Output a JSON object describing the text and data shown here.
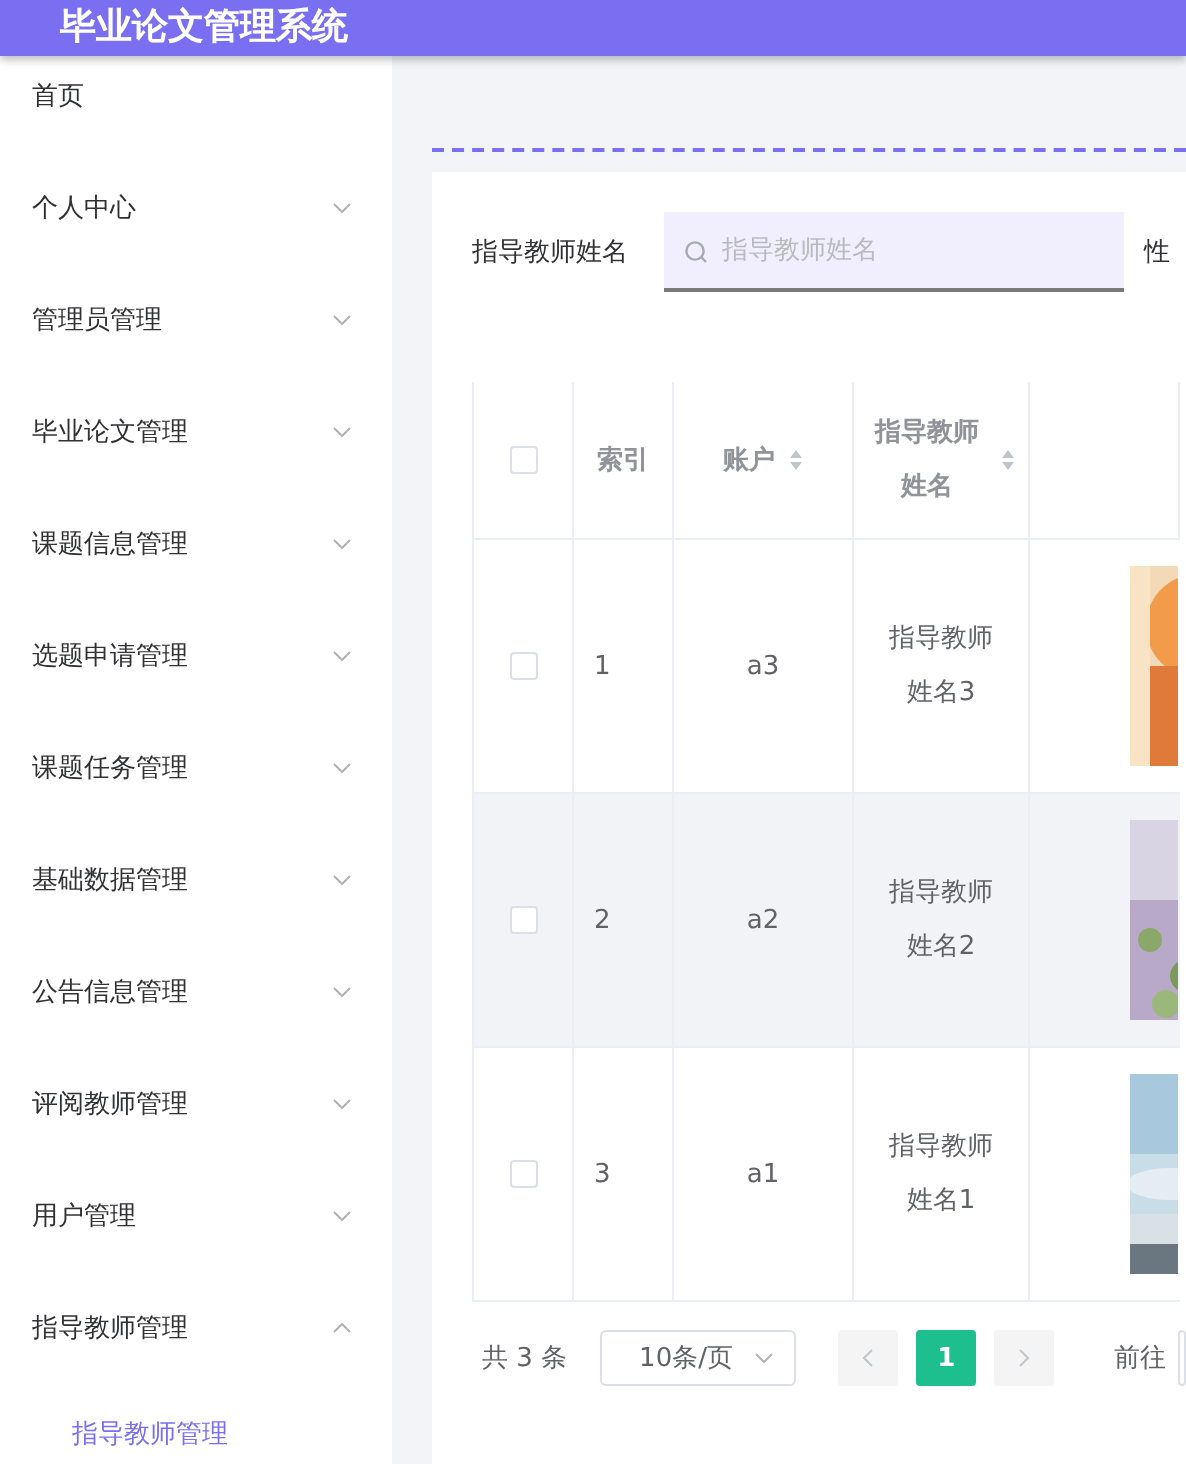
{
  "header": {
    "title": "毕业论文管理系统"
  },
  "sidebar": {
    "items": [
      {
        "label": "首页",
        "has_children": false
      },
      {
        "label": "个人中心",
        "has_children": true,
        "expanded": false
      },
      {
        "label": "管理员管理",
        "has_children": true,
        "expanded": false
      },
      {
        "label": "毕业论文管理",
        "has_children": true,
        "expanded": false
      },
      {
        "label": "课题信息管理",
        "has_children": true,
        "expanded": false
      },
      {
        "label": "选题申请管理",
        "has_children": true,
        "expanded": false
      },
      {
        "label": "课题任务管理",
        "has_children": true,
        "expanded": false
      },
      {
        "label": "基础数据管理",
        "has_children": true,
        "expanded": false
      },
      {
        "label": "公告信息管理",
        "has_children": true,
        "expanded": false
      },
      {
        "label": "评阅教师管理",
        "has_children": true,
        "expanded": false
      },
      {
        "label": "用户管理",
        "has_children": true,
        "expanded": false
      },
      {
        "label": "指导教师管理",
        "has_children": true,
        "expanded": true,
        "children": [
          {
            "label": "指导教师管理",
            "selected": true
          }
        ]
      }
    ]
  },
  "search": {
    "label": "指导教师姓名",
    "placeholder": "指导教师姓名",
    "next_label": "性"
  },
  "table": {
    "columns": [
      {
        "kind": "checkbox"
      },
      {
        "kind": "text",
        "label": "索引",
        "sortable": false
      },
      {
        "kind": "text",
        "label": "账户",
        "sortable": true
      },
      {
        "kind": "text",
        "label": "指导教师姓名",
        "sortable": true
      },
      {
        "kind": "picture"
      }
    ],
    "header_checked": false,
    "rows": [
      {
        "checked": false,
        "highlighted": false,
        "index": "1",
        "account": "a3",
        "name": "指导教师姓名3",
        "photo": {
          "kind": "picture"
        }
      },
      {
        "checked": false,
        "highlighted": true,
        "index": "2",
        "account": "a2",
        "name": "指导教师姓名2",
        "photo": {
          "kind": "picture"
        }
      },
      {
        "checked": false,
        "highlighted": false,
        "index": "3",
        "account": "a1",
        "name": "指导教师姓名1",
        "photo": {
          "kind": "picture"
        }
      }
    ]
  },
  "pagination": {
    "total": "共 3 条",
    "page_size": "10条/页",
    "pages": [
      {
        "label": "1",
        "selected": true
      }
    ],
    "goto_label": "前往"
  }
}
